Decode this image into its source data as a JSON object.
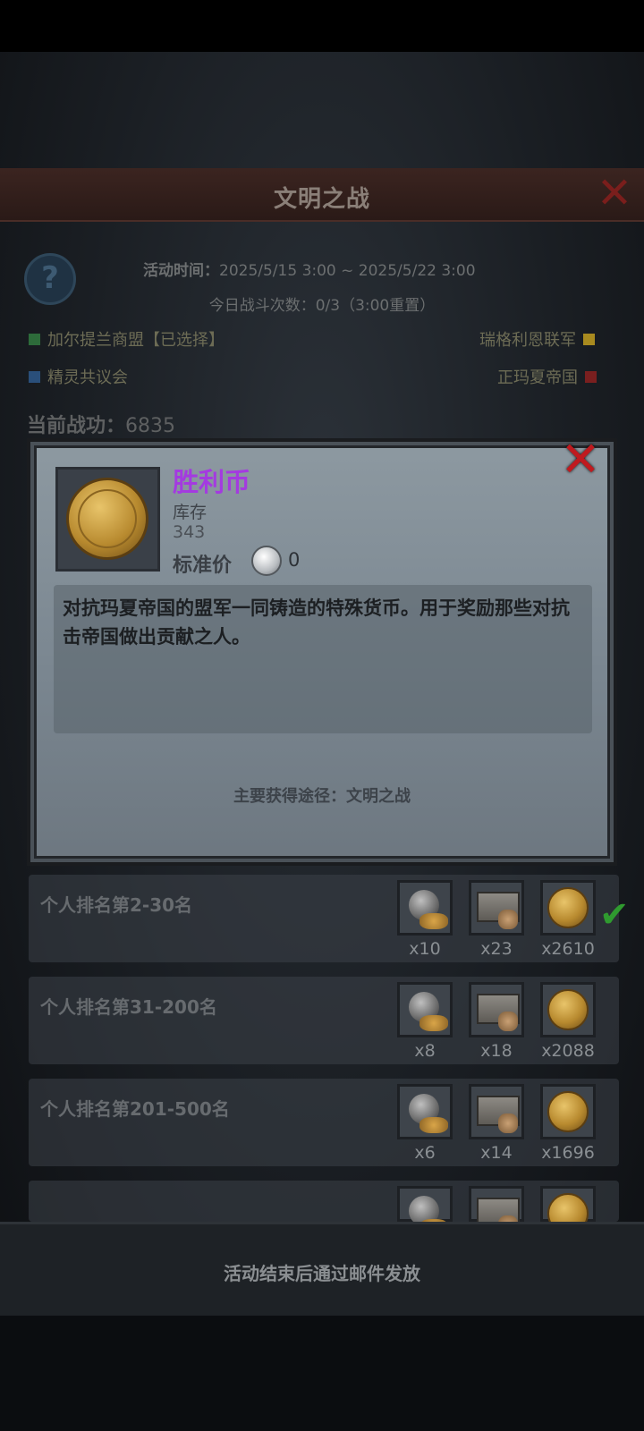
{
  "main": {
    "title": "文明之战",
    "event_time_label": "活动时间：",
    "event_time_value": "2025/5/15 3:00 ~ 2025/5/22 3:00",
    "battles_label": "今日战斗次数：0/3（3:00重置）",
    "merit_label": "当前战功：",
    "merit_value": "6835"
  },
  "factions": [
    {
      "label": "加尔提兰商盟【已选择】",
      "color": "#2d6b3a"
    },
    {
      "label": "瑞格利恩联军",
      "color": "#a88a1f"
    },
    {
      "label": "精灵共议会",
      "color": "#2a4f7a"
    },
    {
      "label": "正玛夏帝国",
      "color": "#7a1f1f"
    }
  ],
  "popup": {
    "item_name": "胜利币",
    "stock_label": "库存",
    "stock_value": "343",
    "price_label": "标准价",
    "price_value": "0",
    "description": "对抗玛夏帝国的盟军一同铸造的特殊货币。用于奖励那些对抗击帝国做出贡献之人。",
    "source": "主要获得途径：文明之战"
  },
  "rewards": [
    {
      "label": "个人排名第2-30名",
      "items": [
        "x10",
        "x23",
        "x2610"
      ],
      "claimed": true
    },
    {
      "label": "个人排名第31-200名",
      "items": [
        "x8",
        "x18",
        "x2088"
      ],
      "claimed": false
    },
    {
      "label": "个人排名第201-500名",
      "items": [
        "x6",
        "x14",
        "x1696"
      ],
      "claimed": false
    }
  ],
  "bottom": {
    "text": "活动结束后通过邮件发放"
  },
  "icons": {
    "close": "close-x-icon",
    "help": "question-icon",
    "coin": "victory-coin-icon",
    "silver": "silver-coin-icon",
    "potion": "potion-icon",
    "chest": "chest-icon",
    "check": "checkmark-icon"
  }
}
